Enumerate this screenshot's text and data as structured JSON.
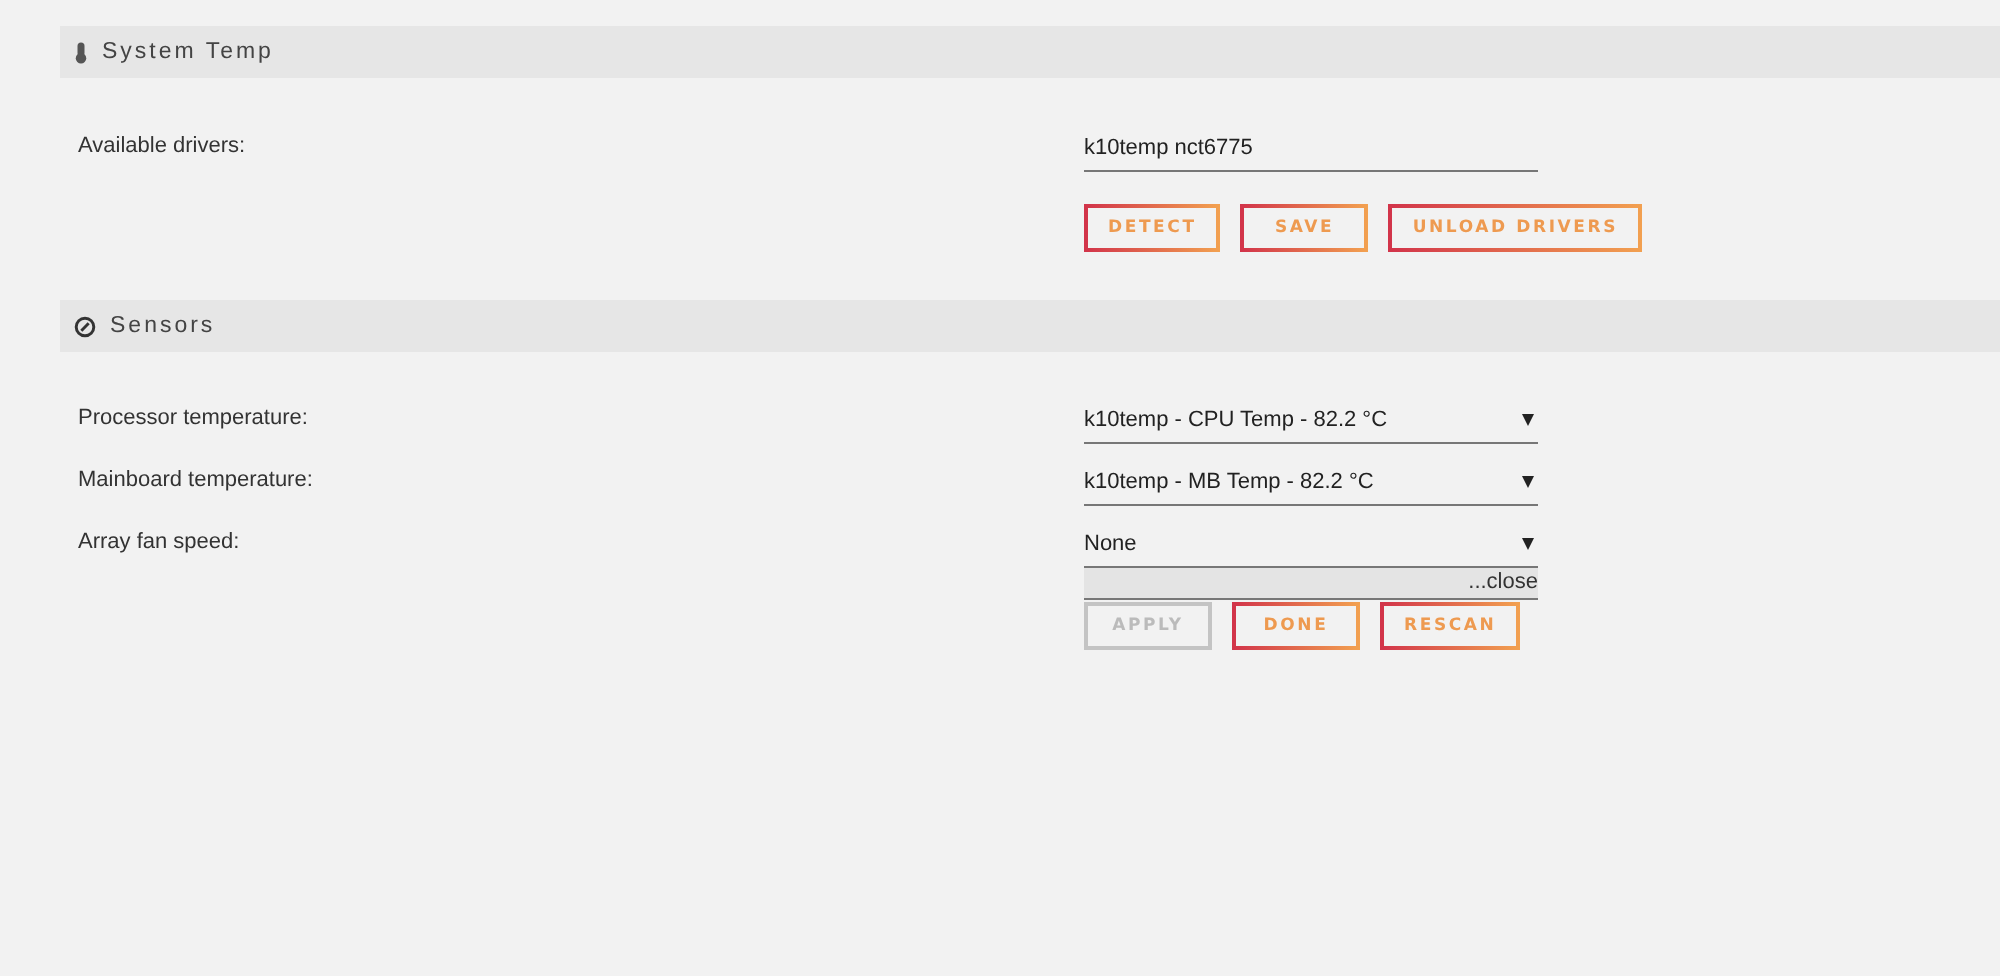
{
  "system_temp": {
    "title": "System Temp",
    "label": "Available drivers:",
    "value": "k10temp nct6775",
    "buttons": [
      {
        "label": "DETECT",
        "disabled": false
      },
      {
        "label": "SAVE",
        "disabled": false
      },
      {
        "label": "UNLOAD DRIVERS",
        "disabled": false
      }
    ]
  },
  "sensors": {
    "title": "Sensors",
    "rows": [
      {
        "label": "Processor temperature:",
        "value": "k10temp - CPU Temp - 82.2 °C"
      },
      {
        "label": "Mainboard temperature:",
        "value": "k10temp - MB Temp - 82.2 °C"
      },
      {
        "label": "Array fan speed:",
        "value": "None"
      }
    ],
    "close": "...close",
    "buttons": [
      {
        "label": "APPLY",
        "disabled": true
      },
      {
        "label": "DONE",
        "disabled": false
      },
      {
        "label": "RESCAN",
        "disabled": false
      }
    ]
  }
}
